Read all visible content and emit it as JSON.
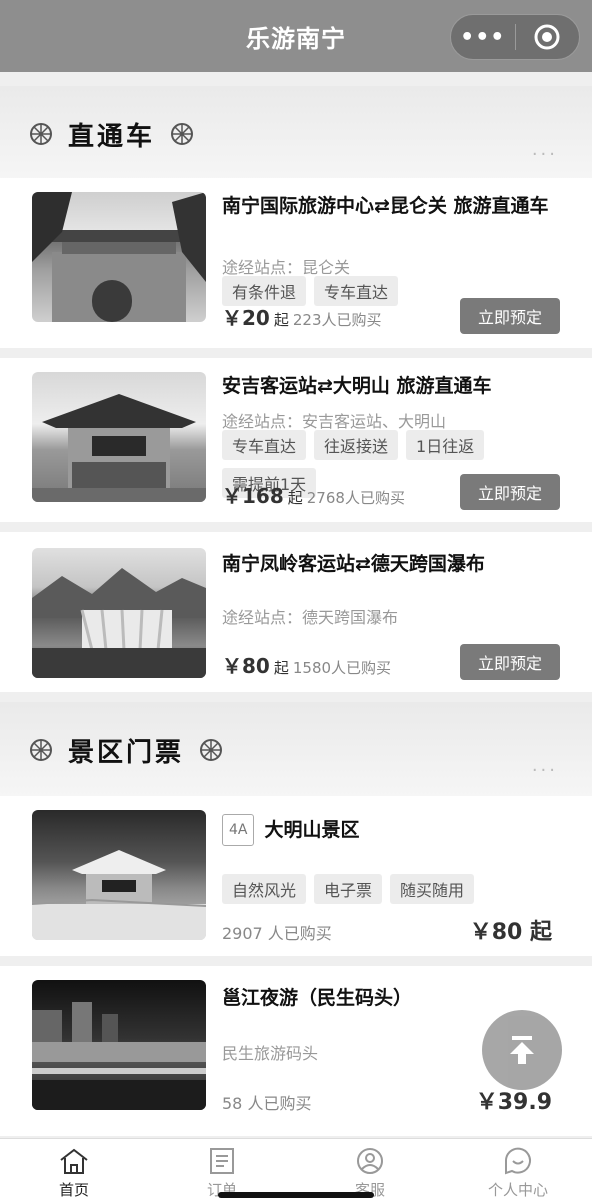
{
  "header": {
    "title": "乐游南宁",
    "menu_icon": "more-dots-icon",
    "close_icon": "target-icon"
  },
  "sections": {
    "direct_bus": {
      "title": "直通车",
      "more": "···"
    },
    "tickets": {
      "title": "景区门票",
      "more": "···"
    }
  },
  "direct_bus": [
    {
      "title": "南宁国际旅游中心⇄昆仑关 旅游直通车",
      "via": "途经站点：昆仑关",
      "tags": [
        "有条件退",
        "专车直达"
      ],
      "price": "￥20",
      "price_suffix": "起",
      "bought": "223人已购买",
      "button": "立即预定"
    },
    {
      "title": "安吉客运站⇄大明山 旅游直通车",
      "via": "途经站点：安吉客运站、大明山",
      "tags": [
        "专车直达",
        "往返接送",
        "1日往返",
        "需提前1天"
      ],
      "price": "￥168",
      "price_suffix": "起",
      "bought": "2768人已购买",
      "button": "立即预定"
    },
    {
      "title": "南宁凤岭客运站⇄德天跨国瀑布",
      "via": "途经站点：德天跨国瀑布",
      "tags": [],
      "price": "￥80",
      "price_suffix": "起",
      "bought": "1580人已购买",
      "button": "立即预定"
    }
  ],
  "tickets": [
    {
      "grade": "4A",
      "title": "大明山景区",
      "tags": [
        "自然风光",
        "电子票",
        "随买随用"
      ],
      "bought": "2907 人已购买",
      "price": "￥80 起"
    },
    {
      "title": "邕江夜游（民生码头）",
      "location": "民生旅游码头",
      "bought": "58 人已购买",
      "price": "￥39.9"
    }
  ],
  "tabbar": [
    {
      "label": "首页",
      "icon": "home-icon"
    },
    {
      "label": "订单",
      "icon": "order-icon"
    },
    {
      "label": "客服",
      "icon": "service-icon"
    },
    {
      "label": "个人中心",
      "icon": "profile-icon"
    }
  ]
}
